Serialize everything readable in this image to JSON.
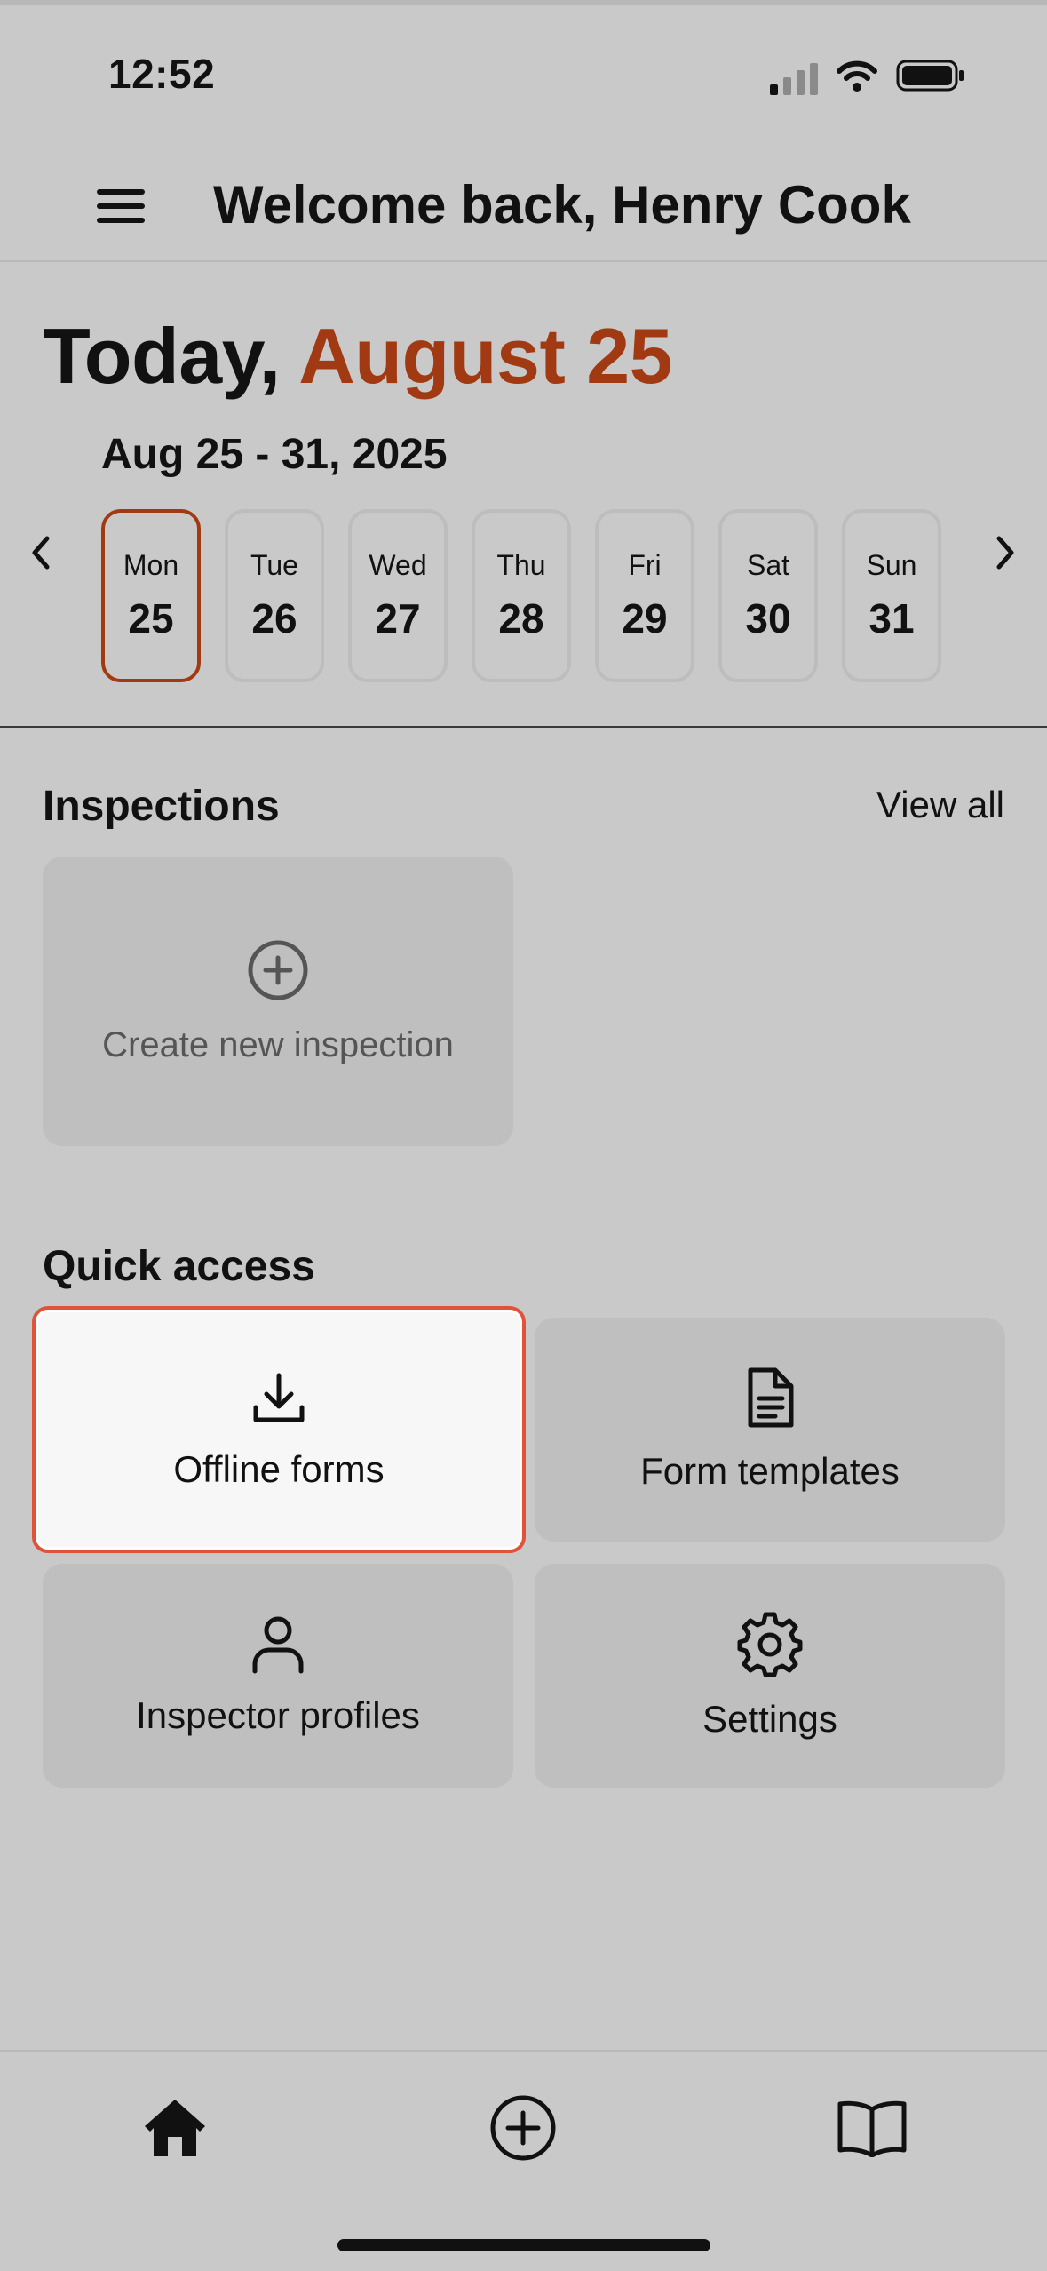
{
  "status_bar": {
    "time": "12:52",
    "icons": [
      "signal-icon",
      "wifi-icon",
      "battery-icon"
    ]
  },
  "header": {
    "menu_icon": "menu-icon",
    "title": "Welcome back, Henry Cook"
  },
  "today": {
    "prefix": "Today,",
    "date": "August 25",
    "accent_color": "#a13a12"
  },
  "week": {
    "range": "Aug 25 - 31, 2025",
    "prev_icon": "chevron-left-icon",
    "next_icon": "chevron-right-icon",
    "selected_index": 0,
    "days": [
      {
        "name": "Mon",
        "num": "25"
      },
      {
        "name": "Tue",
        "num": "26"
      },
      {
        "name": "Wed",
        "num": "27"
      },
      {
        "name": "Thu",
        "num": "28"
      },
      {
        "name": "Fri",
        "num": "29"
      },
      {
        "name": "Sat",
        "num": "30"
      },
      {
        "name": "Sun",
        "num": "31"
      }
    ]
  },
  "inspections": {
    "title": "Inspections",
    "view_all": "View all",
    "create_label": "Create new inspection",
    "create_icon": "plus-circle-icon"
  },
  "quick_access": {
    "title": "Quick access",
    "items": [
      {
        "label": "Offline forms",
        "icon": "download-icon",
        "active": true
      },
      {
        "label": "Form templates",
        "icon": "document-icon",
        "active": false
      },
      {
        "label": "Inspector profiles",
        "icon": "user-icon",
        "active": false
      },
      {
        "label": "Settings",
        "icon": "gear-icon",
        "active": false
      }
    ],
    "highlight_color": "#e0533a"
  },
  "bottom_nav": {
    "items": [
      "home-icon",
      "add-circle-icon",
      "book-icon"
    ]
  }
}
